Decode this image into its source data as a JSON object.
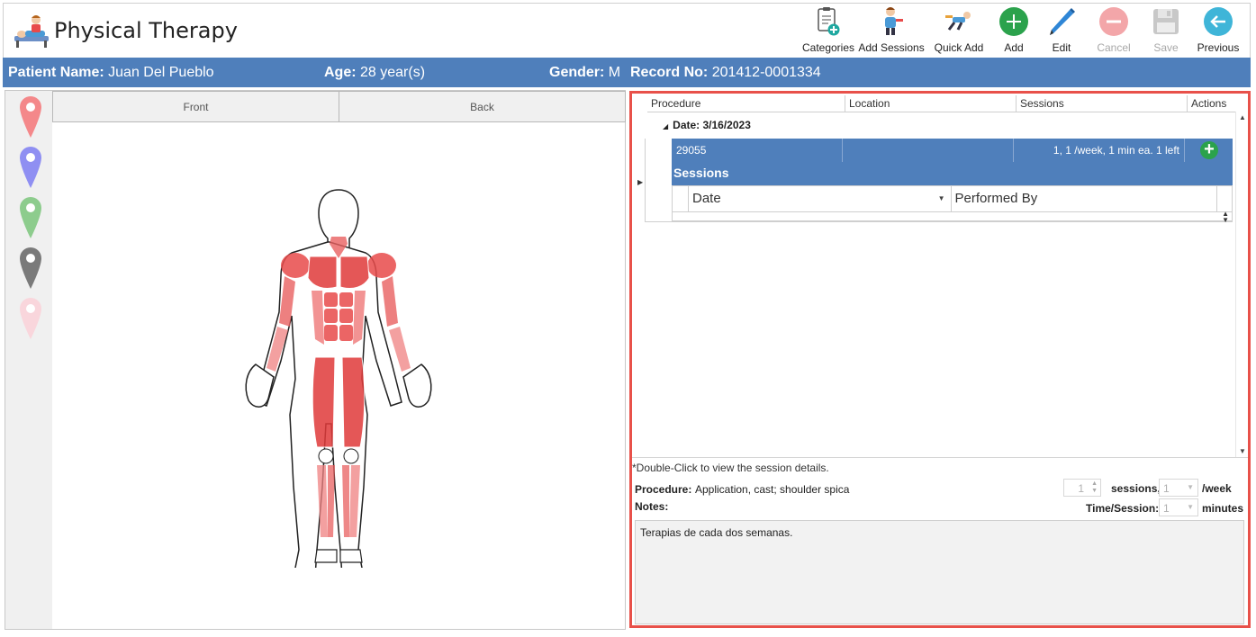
{
  "app": {
    "title": "Physical Therapy",
    "logo_icon": "therapy-logo-icon"
  },
  "toolbar": {
    "categories": "Categories",
    "add_sessions": "Add Sessions",
    "quick_add": "Quick Add",
    "add": "Add",
    "edit": "Edit",
    "cancel": "Cancel",
    "save": "Save",
    "previous": "Previous"
  },
  "patient": {
    "name_label": "Patient Name:",
    "name": "Juan Del Pueblo",
    "age_label": "Age:",
    "age": "28 year(s)",
    "gender_label": "Gender:",
    "gender": "M",
    "record_label": "Record No:",
    "record": "201412-0001334"
  },
  "body_view": {
    "tabs": [
      "Front",
      "Back"
    ],
    "pin_colors": [
      "#f4888a",
      "#8f8ff2",
      "#8dcc8d",
      "#7a7a7a",
      "#f9d6dc"
    ]
  },
  "grid": {
    "columns": [
      "Procedure",
      "Location",
      "Sessions",
      "Actions"
    ],
    "group": "Date: 3/16/2023",
    "rows": [
      {
        "procedure": "29055",
        "location": "",
        "sessions": "1, 1 /week, 1 min ea.  1 left"
      }
    ],
    "sessions_title": "Sessions",
    "sub_columns": [
      "Date",
      "Performed By"
    ]
  },
  "details": {
    "hint": "*Double-Click to view the session details.",
    "procedure_label": "Procedure:",
    "procedure_value": "Application, cast; shoulder spica",
    "notes_label": "Notes:",
    "sessions_count": "1",
    "sessions_label": "sessions,",
    "per_week": "1",
    "per_week_label": "/week",
    "time_label": "Time/Session:",
    "time_value": "1",
    "minutes_label": "minutes",
    "notes_text": "Terapias de cada dos semanas."
  },
  "colors": {
    "header_bar": "#4f7fbb",
    "selected_row": "#4f7fbb",
    "highlight_border": "#e8514a",
    "muscle": "#e84a4a"
  }
}
